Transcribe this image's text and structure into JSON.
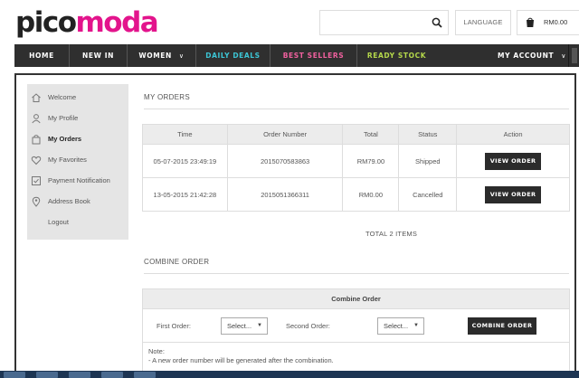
{
  "header": {
    "logo_part1": "pico",
    "logo_part2": "moda",
    "search_placeholder": "",
    "language_label": "LANGUAGE",
    "cart_total": "RM0.00"
  },
  "nav": {
    "items": [
      "HOME",
      "NEW IN",
      "WOMEN",
      "DAILY DEALS",
      "BEST SELLERS",
      "READY STOCK",
      "MY ACCOUNT"
    ],
    "colors": {
      "default": "#ffffff",
      "daily_deals": "#3cc6d6",
      "best_sellers": "#f0609e",
      "ready_stock": "#b5d84b"
    }
  },
  "sidebar": {
    "items": [
      {
        "label": "Welcome",
        "icon": "home-icon"
      },
      {
        "label": "My Profile",
        "icon": "user-icon"
      },
      {
        "label": "My Orders",
        "icon": "bag-icon"
      },
      {
        "label": "My Favorites",
        "icon": "heart-icon"
      },
      {
        "label": "Payment Notification",
        "icon": "payment-icon"
      },
      {
        "label": "Address Book",
        "icon": "location-icon"
      },
      {
        "label": "Logout",
        "icon": ""
      }
    ],
    "active": "My Orders"
  },
  "orders": {
    "title": "MY ORDERS",
    "columns": [
      "Time",
      "Order Number",
      "Total",
      "Status",
      "Action"
    ],
    "rows": [
      {
        "time": "05-07-2015 23:49:19",
        "order_number": "2015070583863",
        "total": "RM79.00",
        "status": "Shipped",
        "action": "VIEW ORDER"
      },
      {
        "time": "13-05-2015 21:42:28",
        "order_number": "2015051366311",
        "total": "RM0.00",
        "status": "Cancelled",
        "action": "VIEW ORDER"
      }
    ],
    "total_items": "TOTAL 2 ITEMS"
  },
  "combine": {
    "title": "COMBINE ORDER",
    "table_title": "Combine Order",
    "first_label": "First Order:",
    "second_label": "Second Order:",
    "first_select": "Select...",
    "second_select": "Select...",
    "button": "COMBINE ORDER",
    "note_title": "Note:",
    "note_line1": "- A new order number will be generated after the combination."
  },
  "colors": {
    "brand_pink": "#e3148c",
    "nav_bg": "#2f2f2f",
    "button_bg": "#2b2b2b"
  }
}
